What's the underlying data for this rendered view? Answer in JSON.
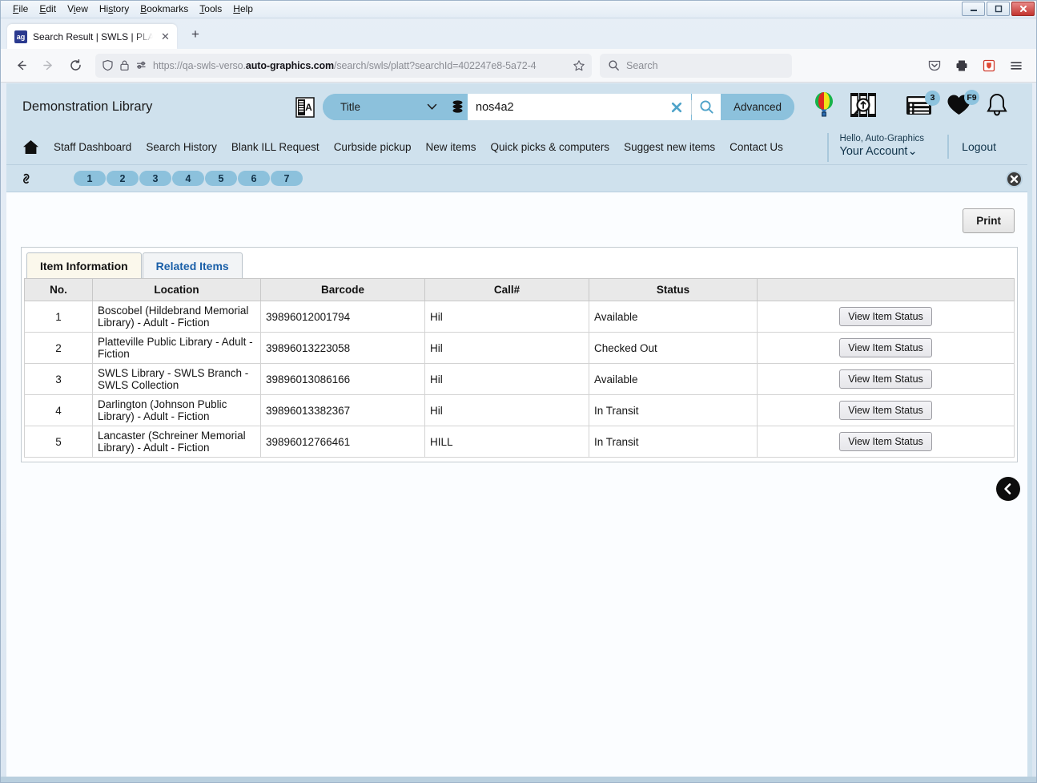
{
  "browser": {
    "menus": [
      "File",
      "Edit",
      "View",
      "History",
      "Bookmarks",
      "Tools",
      "Help"
    ],
    "window_controls": [
      "minimize-button",
      "maximize-button",
      "close-button"
    ],
    "tab": {
      "title": "Search Result | SWLS | PLATT | A",
      "favicon": "ag",
      "close_label": "✕",
      "new_tab_label": "+"
    },
    "nav": {
      "back": "←",
      "forward": "→",
      "reload": "↻"
    },
    "url": {
      "prefix": "https://qa-swls-verso.",
      "domain": "auto-graphics.com",
      "suffix": "/search/swls/platt?searchId=402247e8-5a72-4"
    },
    "search_placeholder": "Search",
    "toolbar_icons": [
      "shield-icon",
      "lock-icon",
      "permissions-icon",
      "bookmark-star-icon",
      "pocket-icon",
      "print-icon",
      "extension-icon",
      "app-menu-icon"
    ]
  },
  "app": {
    "brand": "Demonstration Library",
    "search": {
      "scope": "Title",
      "query": "nos4a2",
      "advanced_label": "Advanced",
      "clear_label": "✖",
      "go_label": "search-icon",
      "language_icon": "translate-icon",
      "database_icon": "database-icon"
    },
    "header_icons": [
      {
        "name": "balloon-icon",
        "badge": ""
      },
      {
        "name": "shelf-search-icon",
        "badge": ""
      },
      {
        "name": "my-lists-icon",
        "badge": "3"
      },
      {
        "name": "favorites-heart-icon",
        "badge": "F9"
      },
      {
        "name": "notifications-bell-icon",
        "badge": ""
      }
    ],
    "nav_links": [
      "Staff Dashboard",
      "Search History",
      "Blank ILL Request",
      "Curbside pickup",
      "New items",
      "Quick picks & computers",
      "Suggest new items",
      "Contact Us"
    ],
    "account": {
      "hello": "Hello, Auto-Graphics",
      "name": "Your Account",
      "caret": "⌄",
      "logout": "Logout"
    },
    "pager": {
      "pages": [
        "1",
        "2",
        "3",
        "4",
        "5",
        "6",
        "7"
      ],
      "close_label": "✕",
      "link_icon": "permalink-icon"
    },
    "content": {
      "print_label": "Print",
      "tabs": [
        {
          "label": "Item Information",
          "active": true
        },
        {
          "label": "Related Items",
          "active": false
        }
      ],
      "table": {
        "columns": [
          "No.",
          "Location",
          "Barcode",
          "Call#",
          "Status",
          ""
        ],
        "rows": [
          {
            "no": "1",
            "location": "Boscobel (Hildebrand Memorial Library) - Adult - Fiction",
            "barcode": "39896012001794",
            "call": "Hil",
            "status": "Available",
            "action": "View Item Status"
          },
          {
            "no": "2",
            "location": "Platteville Public Library - Adult - Fiction",
            "barcode": "39896013223058",
            "call": "Hil",
            "status": "Checked Out",
            "action": "View Item Status"
          },
          {
            "no": "3",
            "location": "SWLS Library - SWLS Branch - SWLS Collection",
            "barcode": "39896013086166",
            "call": "Hil",
            "status": "Available",
            "action": "View Item Status"
          },
          {
            "no": "4",
            "location": "Darlington (Johnson Public Library) - Adult - Fiction",
            "barcode": "39896013382367",
            "call": "Hil",
            "status": "In Transit",
            "action": "View Item Status"
          },
          {
            "no": "5",
            "location": "Lancaster (Schreiner Memorial Library) - Adult - Fiction",
            "barcode": "39896012766461",
            "call": "HILL",
            "status": "In Transit",
            "action": "View Item Status"
          }
        ]
      },
      "back_button": "back-chevron-icon"
    }
  },
  "colors": {
    "app_header_blue": "#cfe1ed",
    "accent_blue": "#8cc1dc",
    "active_tab_cream": "#fbf8ec",
    "link_blue": "#1a5fa8"
  }
}
